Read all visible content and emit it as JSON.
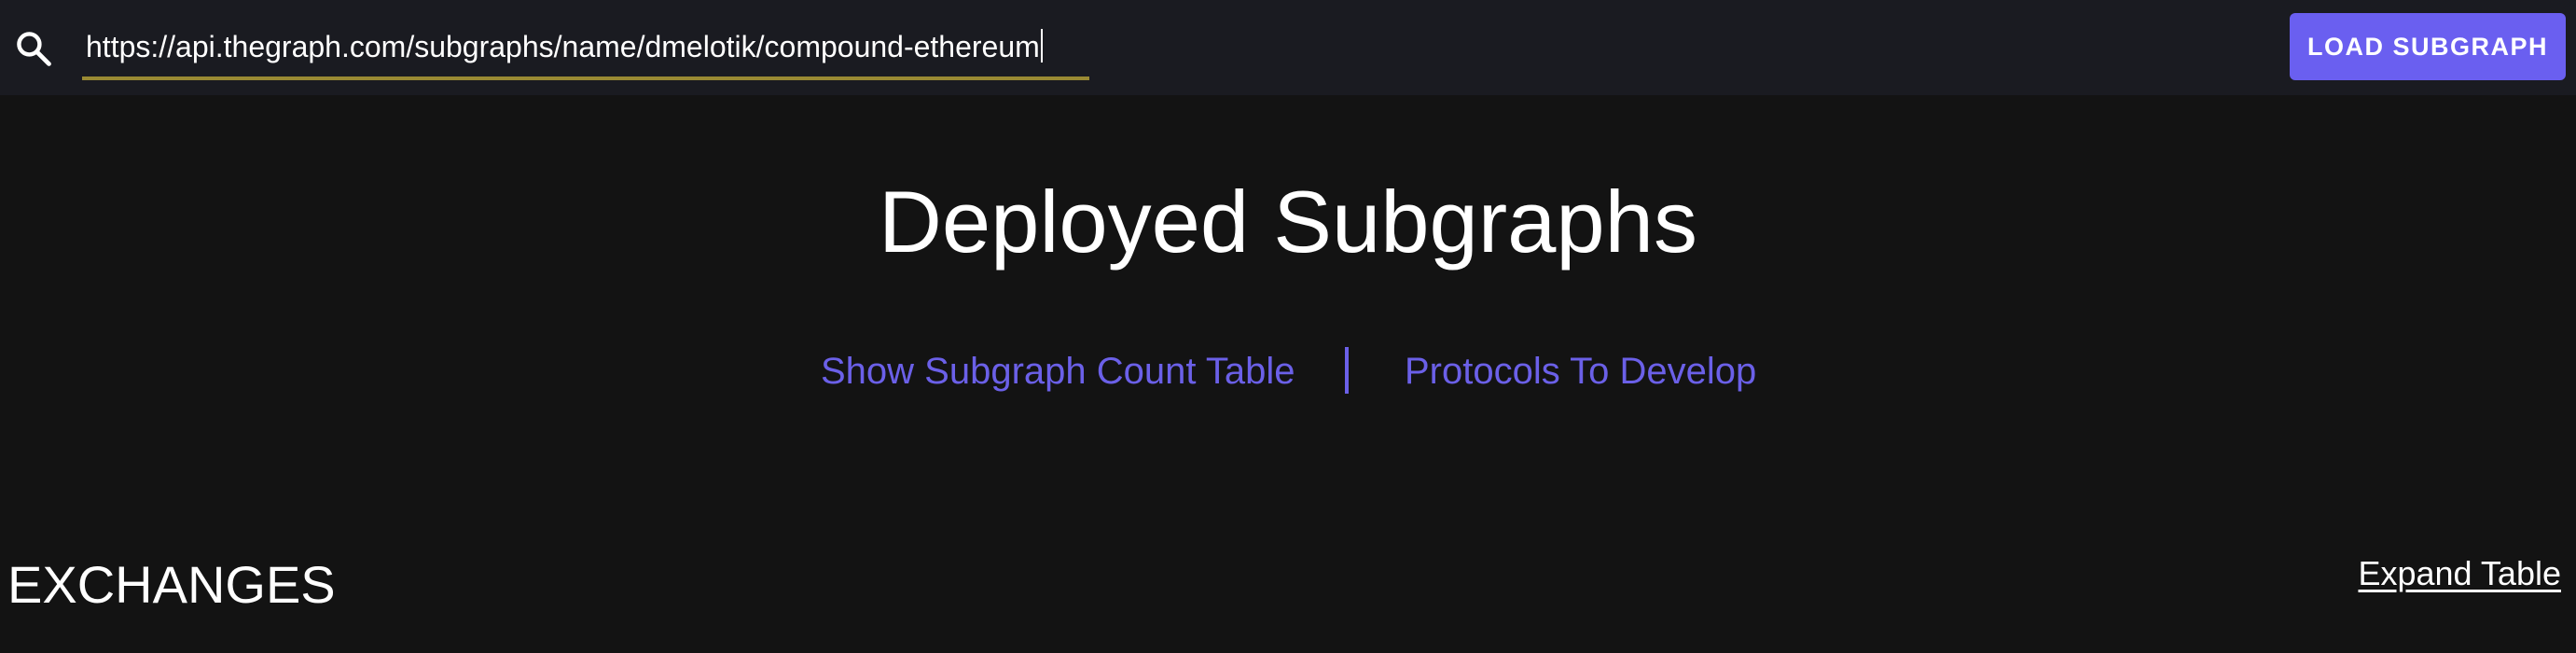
{
  "search": {
    "icon": "search-icon",
    "url_value": "https://api.thegraph.com/subgraphs/name/dmelotik/compound-ethereum",
    "underline_color": "#9a8a33"
  },
  "toolbar": {
    "load_label": "LOAD SUBGRAPH",
    "button_color": "#6a5ff0"
  },
  "main": {
    "title": "Deployed Subgraphs",
    "links": {
      "count_table": "Show Subgraph Count Table",
      "divider": "|",
      "protocols": "Protocols To Develop",
      "link_color": "#6b60e8"
    }
  },
  "section": {
    "title": "EXCHANGES",
    "expand_label": "Expand Table"
  },
  "colors": {
    "page_background": "#131313",
    "topbar_background": "#1a1b21"
  }
}
